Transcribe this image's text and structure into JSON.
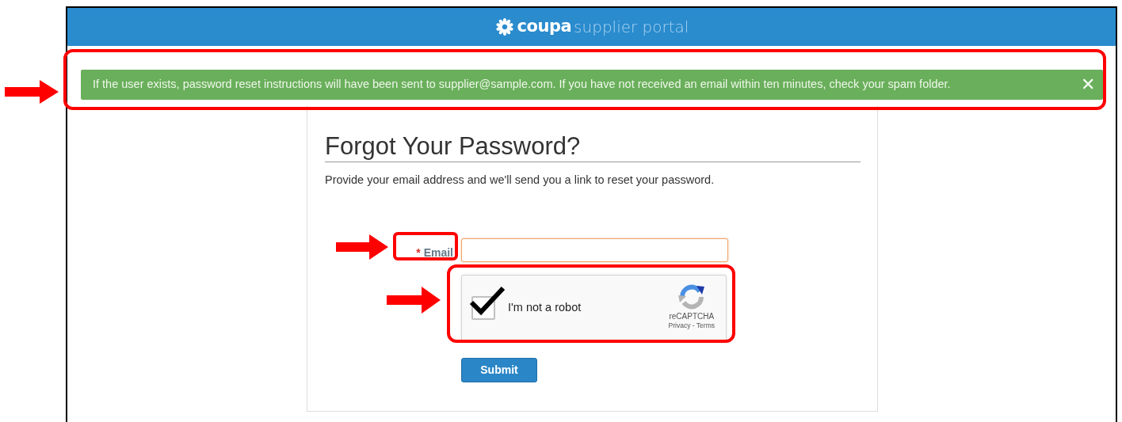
{
  "header": {
    "brand": "coupa",
    "subtitle": "supplier portal"
  },
  "alert": {
    "message": "If the user exists, password reset instructions will have been sent to supplier@sample.com. If you have not received an email within ten minutes, check your spam folder.",
    "close": "✕"
  },
  "form": {
    "title": "Forgot Your Password?",
    "description": "Provide your email address and we'll send you a link to reset your password.",
    "email": {
      "required_mark": "*",
      "label": "Email",
      "focused": true
    },
    "captcha": {
      "label": "I'm not a robot",
      "checked": true,
      "brand": "reCAPTCHA",
      "links": "Privacy - Terms"
    },
    "submit": "Submit"
  }
}
